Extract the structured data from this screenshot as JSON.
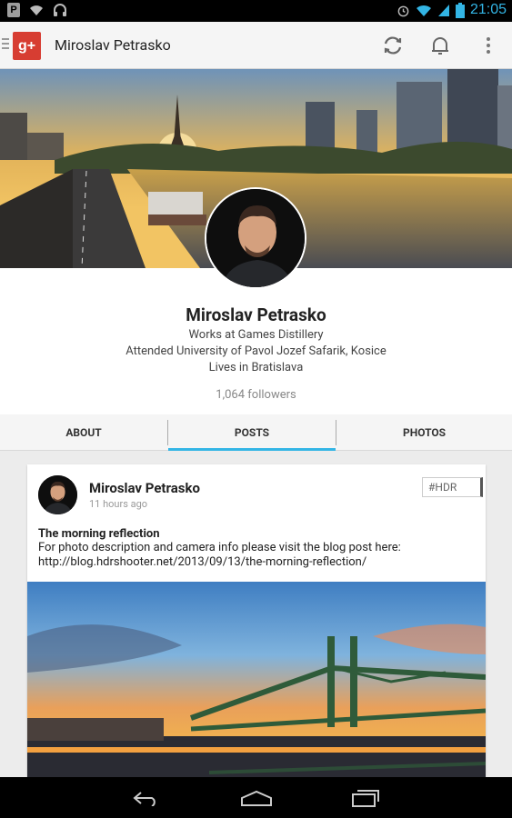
{
  "status_bar": {
    "time": "21:05",
    "left_icons": [
      "p-icon",
      "wifi-icon",
      "headphones-icon"
    ],
    "right_icons": [
      "alarm-icon",
      "wifi-signal-icon",
      "cell-signal-icon",
      "battery-icon"
    ]
  },
  "action_bar": {
    "title": "Miroslav Petrasko",
    "app_logo": "g+",
    "actions": [
      "refresh-icon",
      "notifications-bell-icon",
      "overflow-menu-icon"
    ]
  },
  "profile": {
    "name": "Miroslav Petrasko",
    "work": "Works at Games Distillery",
    "education": "Attended University of Pavol Jozef Safarik, Kosice",
    "location": "Lives in Bratislava",
    "followers": "1,064 followers"
  },
  "tabs": [
    {
      "label": "ABOUT",
      "active": false
    },
    {
      "label": "POSTS",
      "active": true
    },
    {
      "label": "PHOTOS",
      "active": false
    }
  ],
  "post": {
    "author": "Miroslav Petrasko",
    "time": "11 hours ago",
    "tag": "#HDR",
    "title": "The morning reflection",
    "body": "For photo description and camera info please visit the blog post here: http://blog.hdrshooter.net/2013/09/13/the-morning-reflection/"
  },
  "colors": {
    "accent": "#33b5e5",
    "gplus_red": "#d73d32"
  }
}
